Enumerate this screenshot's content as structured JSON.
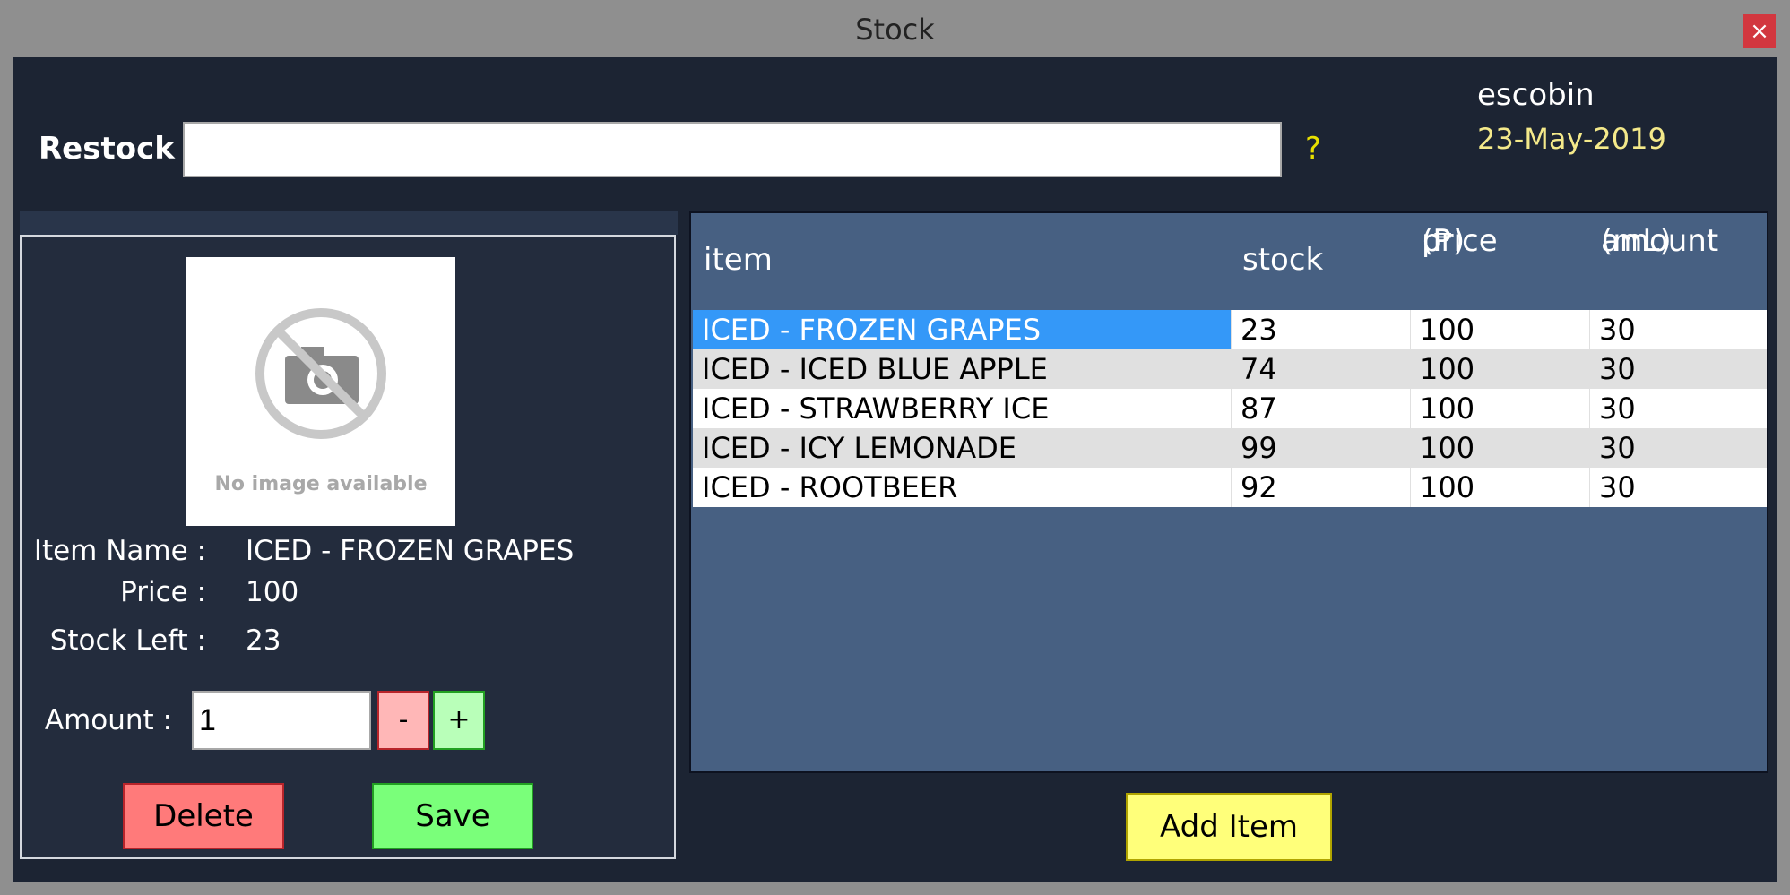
{
  "window": {
    "title": "Stock",
    "close_label": "×"
  },
  "restock": {
    "label": "Restock",
    "value": "",
    "help": "?"
  },
  "user": {
    "name": "escobin",
    "date": "23-May-2019"
  },
  "image": {
    "text": "No image available"
  },
  "details": {
    "item_name_label": "Item Name :",
    "item_name": "ICED - FROZEN GRAPES",
    "price_label": "Price :",
    "price": "100",
    "stock_label": "Stock Left :",
    "stock": "23",
    "amount_label": "Amount :",
    "amount": "1",
    "minus_label": "-",
    "plus_label": "+",
    "delete_label": "Delete",
    "save_label": "Save"
  },
  "table": {
    "headers": [
      {
        "line1": "item",
        "line2": ""
      },
      {
        "line1": "stock",
        "line2": ""
      },
      {
        "line1": "price",
        "line2": "(₱)"
      },
      {
        "line1": "amount",
        "line2": "(mL)"
      }
    ],
    "rows": [
      [
        "ICED - FROZEN GRAPES",
        "23",
        "100",
        "30"
      ],
      [
        "ICED - ICED BLUE APPLE",
        "74",
        "100",
        "30"
      ],
      [
        "ICED - STRAWBERRY ICE",
        "87",
        "100",
        "30"
      ],
      [
        "ICED - ICY LEMONADE",
        "99",
        "100",
        "30"
      ],
      [
        "ICED - ROOTBEER",
        "92",
        "100",
        "30"
      ]
    ],
    "selected_row": 0
  },
  "add_item_label": "Add Item",
  "colors": {
    "background": "#1c2433",
    "grid": "#476082",
    "selection": "#3498f8",
    "delete": "#ff7a7a",
    "save": "#7aff7a",
    "add": "#ffff7a"
  }
}
